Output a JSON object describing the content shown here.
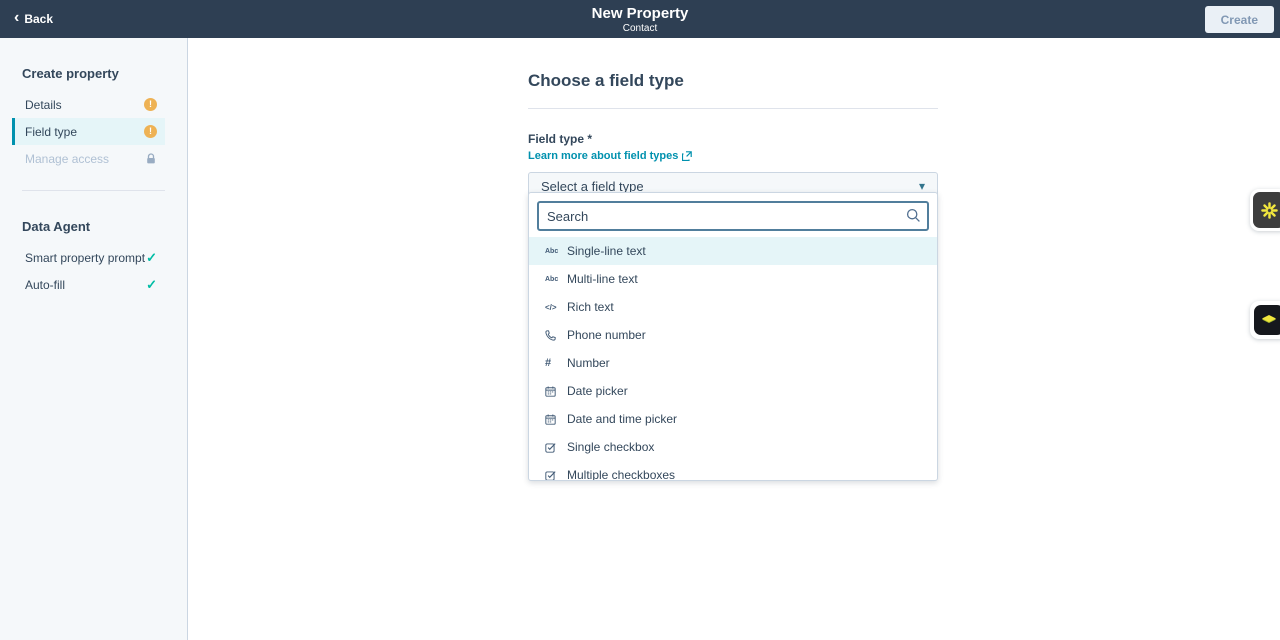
{
  "topbar": {
    "back_label": "Back",
    "title": "New Property",
    "subtitle": "Contact",
    "create_label": "Create"
  },
  "sidebar": {
    "create_property": {
      "title": "Create property",
      "items": [
        {
          "label": "Details",
          "status": "warning",
          "active": false
        },
        {
          "label": "Field type",
          "status": "warning",
          "active": true
        },
        {
          "label": "Manage access",
          "status": "locked",
          "active": false
        }
      ]
    },
    "data_agent": {
      "title": "Data Agent",
      "items": [
        {
          "label": "Smart property prompt",
          "status": "complete"
        },
        {
          "label": "Auto-fill",
          "status": "complete"
        }
      ]
    }
  },
  "main": {
    "heading": "Choose a field type",
    "field_label": "Field type *",
    "learn_more_label": "Learn more about field types",
    "select_value": "Select a field type",
    "search_placeholder": "Search",
    "options": [
      {
        "label": "Single-line text",
        "icon": "single-line-text-icon",
        "selected": true
      },
      {
        "label": "Multi-line text",
        "icon": "multi-line-text-icon",
        "selected": false
      },
      {
        "label": "Rich text",
        "icon": "rich-text-icon",
        "selected": false
      },
      {
        "label": "Phone number",
        "icon": "phone-icon",
        "selected": false
      },
      {
        "label": "Number",
        "icon": "number-icon",
        "selected": false
      },
      {
        "label": "Date picker",
        "icon": "calendar-icon",
        "selected": false
      },
      {
        "label": "Date and time picker",
        "icon": "calendar-icon",
        "selected": false
      },
      {
        "label": "Single checkbox",
        "icon": "checkbox-icon",
        "selected": false
      },
      {
        "label": "Multiple checkboxes",
        "icon": "checkbox-icon",
        "selected": false
      }
    ]
  },
  "colors": {
    "topbar_bg": "#2e3f53",
    "navy_text": "#33475b",
    "sidebar_bg": "#f5f8fa",
    "border": "#cbd6e2",
    "active_item_bg": "#e5f5f8",
    "accent_teal": "#0091ae",
    "warning_amber": "#eeb254",
    "success_green": "#00bda5",
    "search_border": "#517e9c",
    "spark_yellow": "#f2e73e"
  }
}
